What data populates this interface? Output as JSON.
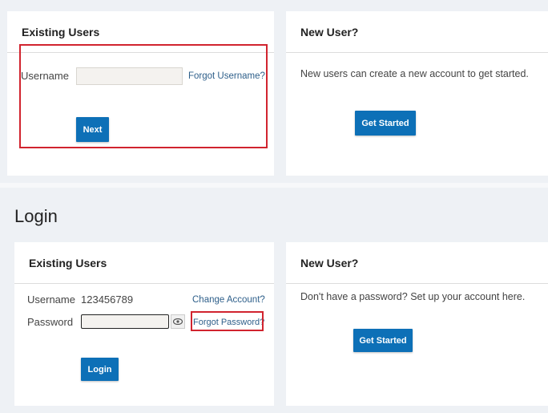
{
  "top": {
    "existing": {
      "title": "Existing Users",
      "username_label": "Username",
      "username_value": "",
      "forgot_username": "Forgot Username?",
      "next_label": "Next"
    },
    "new_user": {
      "title": "New User?",
      "text": "New users can create a new account to get started.",
      "button": "Get Started"
    }
  },
  "login": {
    "heading": "Login",
    "existing": {
      "title": "Existing Users",
      "username_label": "Username",
      "username_value": "123456789",
      "change_account": "Change Account?",
      "password_label": "Password",
      "password_value": "",
      "forgot_password": "Forgot Password?",
      "login_label": "Login"
    },
    "new_user": {
      "title": "New User?",
      "text": "Don't have a password? Set up your account here.",
      "button": "Get Started"
    }
  },
  "colors": {
    "accent": "#0d70b7",
    "highlight": "#d1242f"
  }
}
